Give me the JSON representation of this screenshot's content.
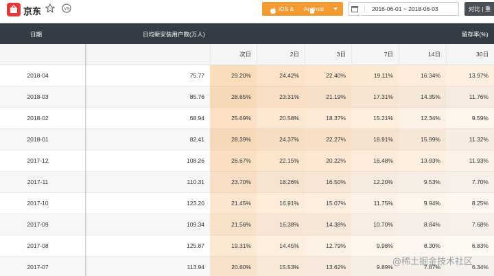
{
  "app": {
    "name": "京东"
  },
  "toolbar": {
    "platform_label": "iOS & ",
    "platform_label2": "Android",
    "date_range": "2016-06-01 ~ 2018-06-03",
    "compare_label": "对比 | 重"
  },
  "table": {
    "header_date": "日期",
    "header_installs": "日均新安装用户数(万人)",
    "header_retention": "留存率(%)",
    "periods": [
      "次日",
      "2日",
      "3日",
      "7日",
      "14日",
      "30日"
    ],
    "rows": [
      {
        "date": "2018-04",
        "installs": "75.77",
        "r": [
          "29.20%",
          "24.42%",
          "22.40%",
          "19.11%",
          "16.34%",
          "13.97%"
        ]
      },
      {
        "date": "2018-03",
        "installs": "85.76",
        "r": [
          "28.65%",
          "23.31%",
          "21.19%",
          "17.31%",
          "14.35%",
          "11.76%"
        ]
      },
      {
        "date": "2018-02",
        "installs": "68.94",
        "r": [
          "25.69%",
          "20.58%",
          "18.37%",
          "15.21%",
          "12.34%",
          "9.59%"
        ]
      },
      {
        "date": "2018-01",
        "installs": "82.41",
        "r": [
          "28.39%",
          "24.37%",
          "22.27%",
          "18.91%",
          "15.99%",
          "11.32%"
        ]
      },
      {
        "date": "2017-12",
        "installs": "108.26",
        "r": [
          "26.67%",
          "22.15%",
          "20.22%",
          "16.48%",
          "13.93%",
          "11.93%"
        ]
      },
      {
        "date": "2017-11",
        "installs": "110.31",
        "r": [
          "23.70%",
          "18.26%",
          "16.50%",
          "12.20%",
          "9.53%",
          "7.70%"
        ]
      },
      {
        "date": "2017-10",
        "installs": "123.20",
        "r": [
          "21.45%",
          "16.91%",
          "15.07%",
          "11.75%",
          "9.94%",
          "8.25%"
        ]
      },
      {
        "date": "2017-09",
        "installs": "109.34",
        "r": [
          "21.56%",
          "16.38%",
          "14.38%",
          "10.70%",
          "8.84%",
          "7.68%"
        ]
      },
      {
        "date": "2017-08",
        "installs": "125.87",
        "r": [
          "19.31%",
          "14.45%",
          "12.79%",
          "9.98%",
          "8.30%",
          "6.83%"
        ]
      },
      {
        "date": "2017-07",
        "installs": "113.94",
        "r": [
          "20.60%",
          "15.53%",
          "13.62%",
          "9.89%",
          "7.87%",
          "6.34%"
        ]
      }
    ]
  },
  "watermark": "@稀土掘金技术社区",
  "colors": {
    "accent": "#f39a32",
    "header_bg": "#343d45",
    "heat": "#f6c48a"
  }
}
